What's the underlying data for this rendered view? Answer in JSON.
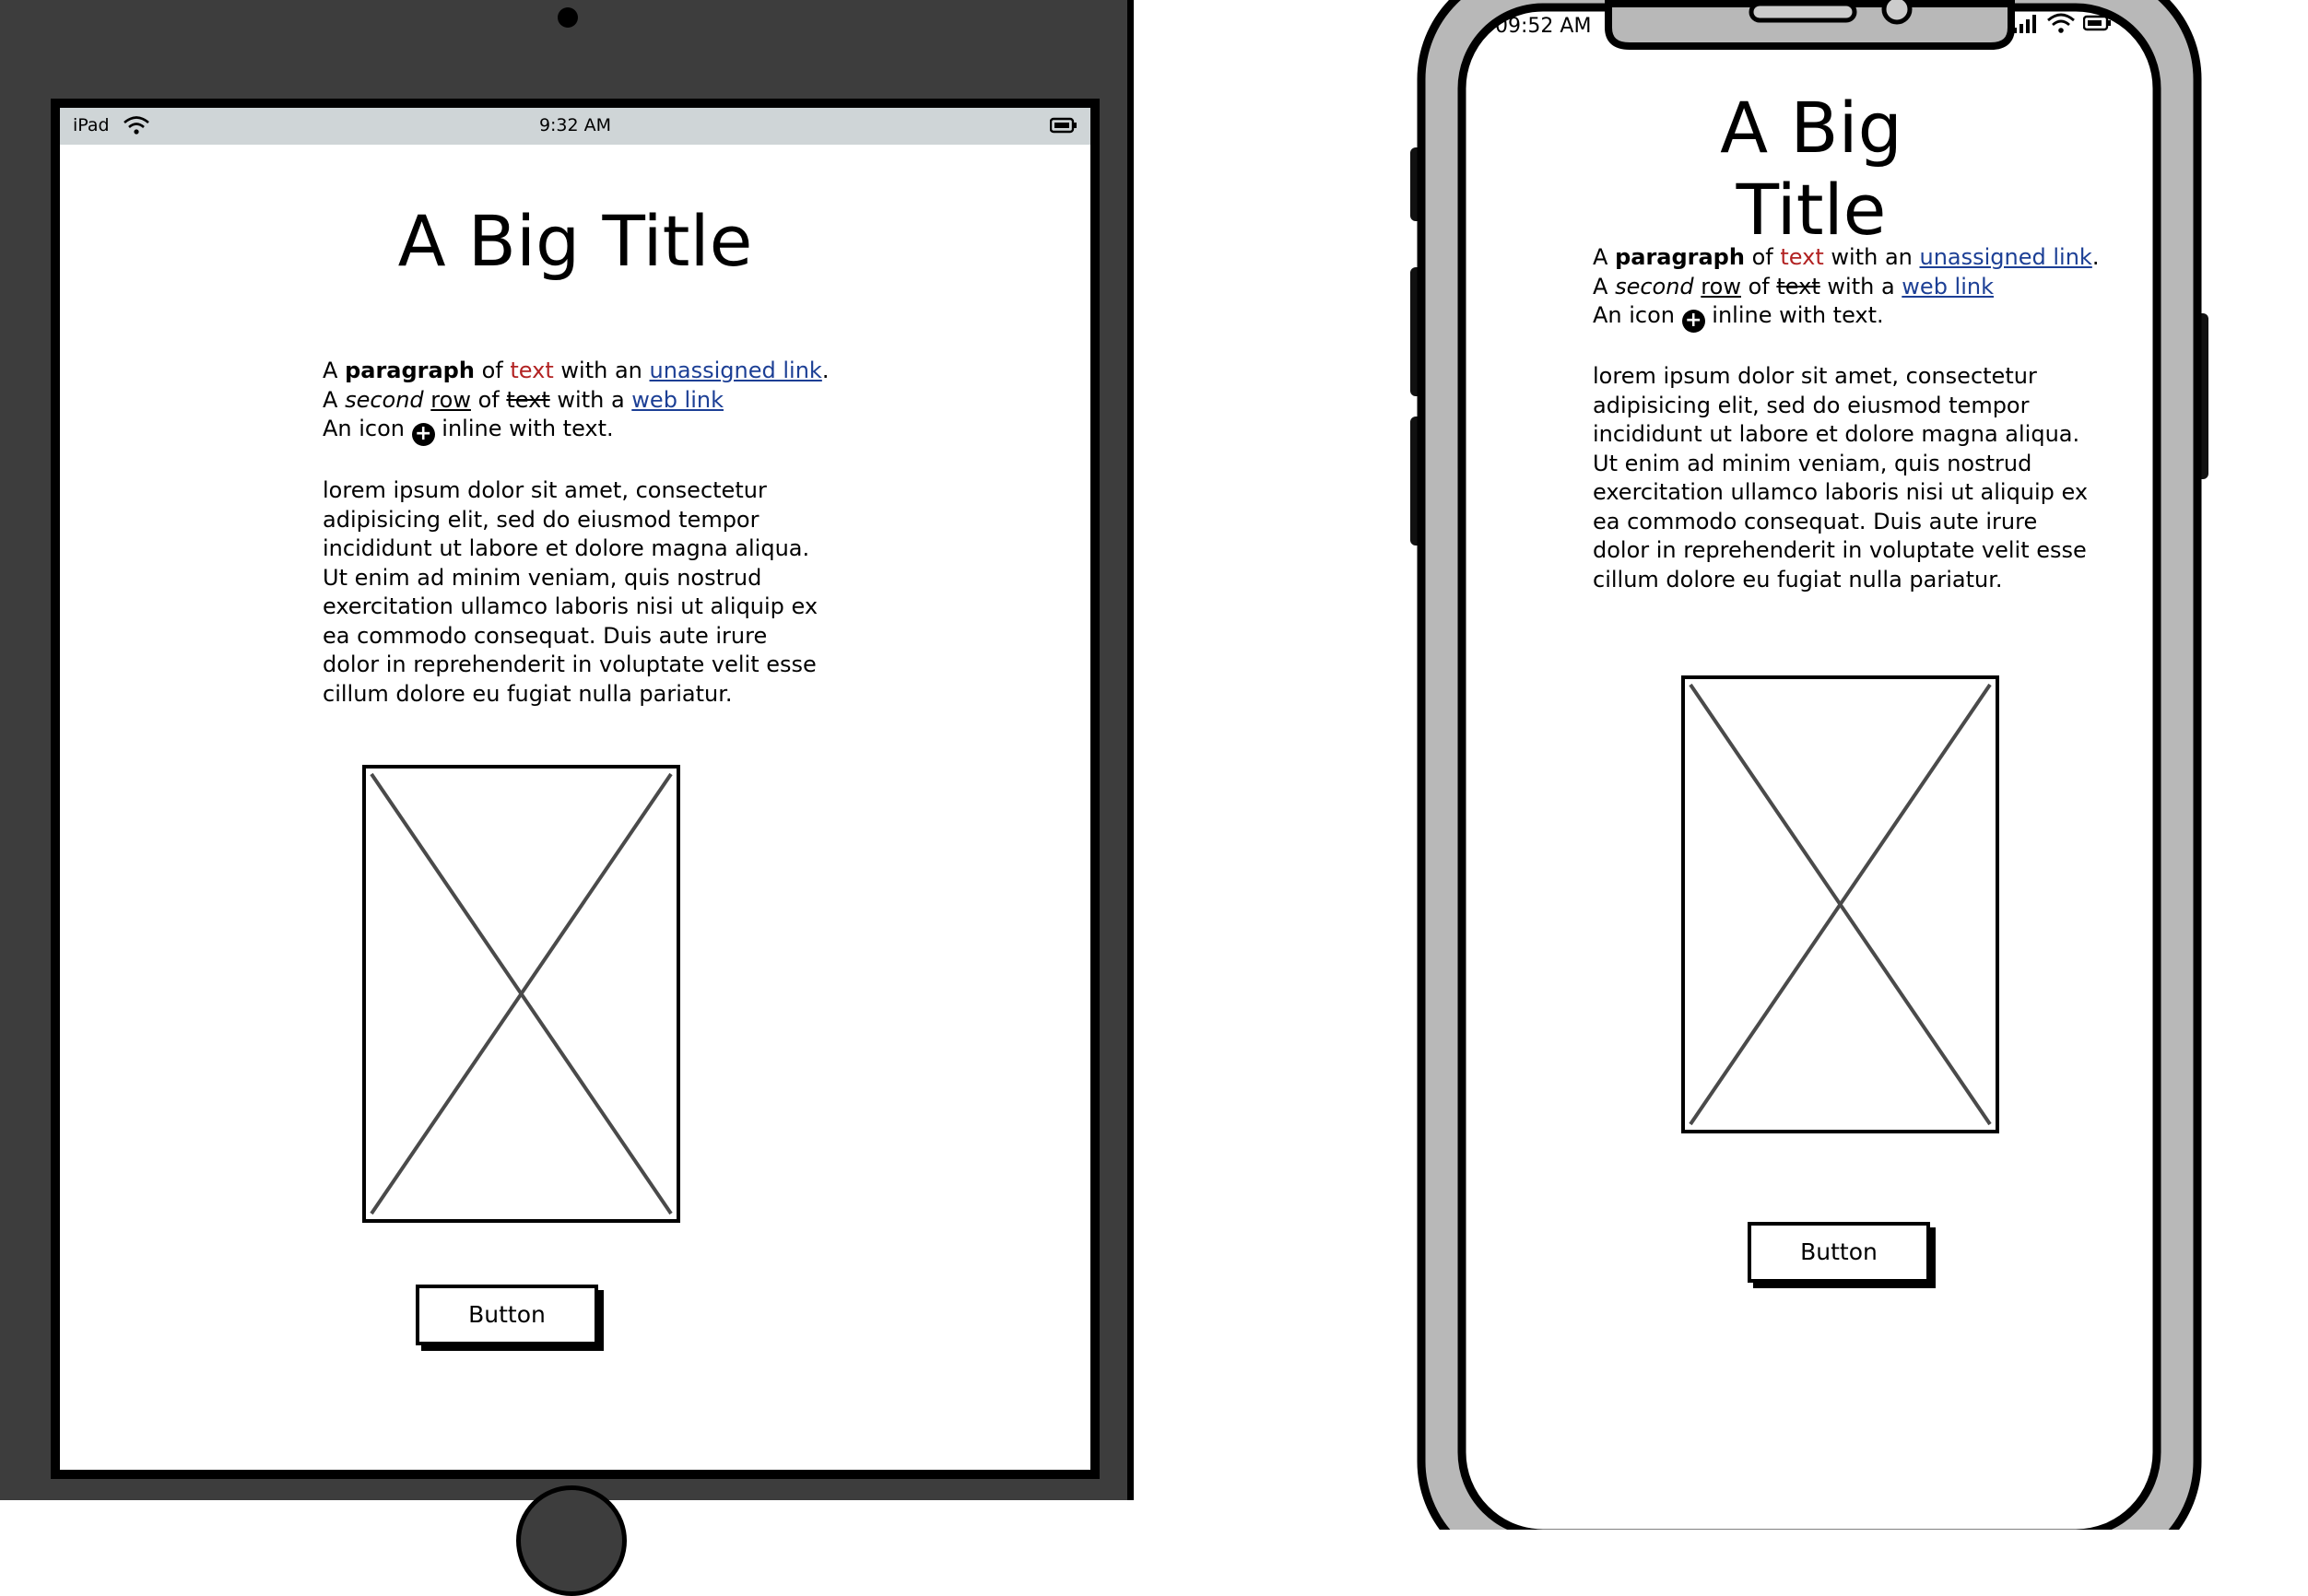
{
  "tablet": {
    "status": {
      "carrier": "iPad",
      "time": "9:32 AM"
    },
    "title": "A Big Title",
    "paragraph": {
      "line1": {
        "a": "A",
        "bold": "paragraph",
        "of": "of",
        "red": "text",
        "mid": "with an",
        "link": "unassigned link",
        "end": "."
      },
      "line2": {
        "a": "A",
        "italic": "second",
        "underline": "row",
        "of": "of",
        "strike": "text",
        "mid": "with a",
        "link": "web link"
      },
      "line3": {
        "pre": "An icon",
        "post": "inline with text."
      }
    },
    "lorem": "lorem ipsum dolor sit amet, consectetur adipisicing elit, sed do eiusmod tempor incididunt ut labore et dolore magna aliqua. Ut enim ad minim veniam, quis nostrud exercitation ullamco laboris nisi ut aliquip ex ea commodo consequat. Duis aute irure dolor in reprehenderit in voluptate velit esse cillum dolore eu fugiat nulla pariatur.",
    "button": "Button"
  },
  "phone": {
    "status": {
      "time": "09:52 AM"
    },
    "title": "A Big Title",
    "paragraph": {
      "line1": {
        "a": "A",
        "bold": "paragraph",
        "of": "of",
        "red": "text",
        "mid": "with an",
        "link": "unassigned link",
        "end": "."
      },
      "line2": {
        "a": "A",
        "italic": "second",
        "underline": "row",
        "of": "of",
        "strike": "text",
        "mid": "with a",
        "link": "web link"
      },
      "line3": {
        "pre": "An icon",
        "post": "inline with text."
      }
    },
    "lorem": "lorem ipsum dolor sit amet, consectetur adipisicing elit, sed do eiusmod tempor incididunt ut labore et dolore magna aliqua. Ut enim ad minim veniam, quis nostrud exercitation ullamco laboris nisi ut aliquip ex ea commodo consequat. Duis aute irure dolor in reprehenderit in voluptate velit esse cillum dolore eu fugiat nulla pariatur.",
    "button": "Button"
  },
  "icons": {
    "inline": "plus-circle-icon",
    "wifi": "wifi-icon",
    "battery": "battery-icon",
    "signal": "signal-icon"
  },
  "colors": {
    "tablet_bezel": "#3d3d3d",
    "status_bar": "#cfd5d7",
    "phone_frame": "#b8b8b8",
    "link": "#1c3f95",
    "red_text": "#b22222"
  }
}
